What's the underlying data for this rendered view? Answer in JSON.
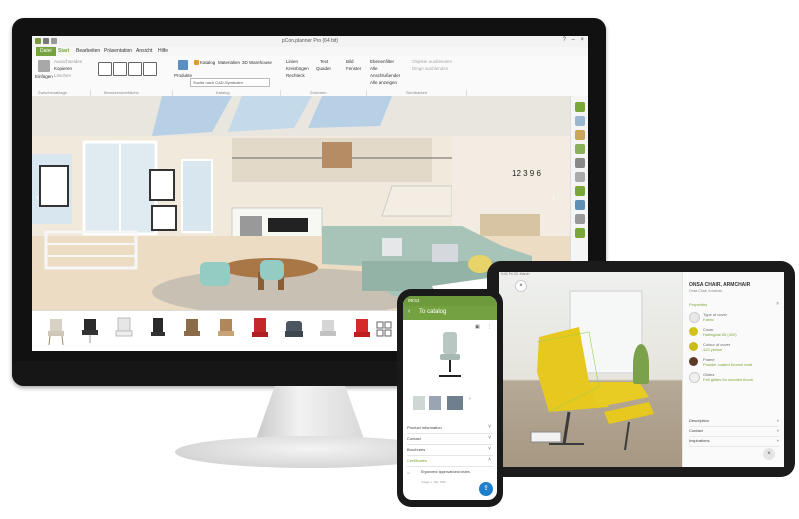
{
  "desktop_app": {
    "title": "pCon.planner Pro (64 bit)",
    "menu": [
      "Datei",
      "Start",
      "Bearbeiten",
      "Präsentation",
      "Ansicht",
      "Hilfe"
    ],
    "ribbon": {
      "paste_label": "Einfügen",
      "clipboard_items": [
        "Ausschneiden",
        "Kopieren",
        "Löschen"
      ],
      "catalog_items": [
        "Katalog",
        "Materialien",
        "3D Warehouse"
      ],
      "products_label": "Produkte",
      "search_placeholder": "Suche nach CAD-Symbolen",
      "draw_items": [
        "Linien",
        "Kreisbögen",
        "Rechteck",
        "Quader",
        "Text",
        "Bild",
        "Fenster"
      ],
      "layer_label": "Ebenenfilter",
      "layer_items": [
        "Alle",
        "Anschlußender",
        "Alle anzeigen",
        "Objekte ausblenden",
        "Dinge ausblenden"
      ],
      "groups": [
        "Zwischenablage",
        "Benutzeroberfläche",
        "Katalog",
        "Zeichnen",
        "Sichtbarkeit"
      ]
    },
    "clock_text": "12 3 9 6"
  },
  "tablet_app": {
    "status_bar": "9:41 Fri 20. March",
    "close_icon": "close-icon",
    "product_title": "ONSA CHAIR, ARMCHAIR",
    "product_subtitle": "Onsa Chair, Armchair",
    "section_properties": "Properties",
    "properties": [
      {
        "label": "Type of cover",
        "value": "Fabric",
        "color": "#e8e8e8"
      },
      {
        "label": "Cover",
        "value": "Hallingdal 65 (420)",
        "color": "#d4c21a"
      },
      {
        "label": "Colour of cover",
        "value": "420 yellow",
        "color": "#cdbb1c"
      },
      {
        "label": "Frame",
        "value": "Powder coated bronze matt",
        "color": "#5b3a26"
      },
      {
        "label": "Glides",
        "value": "Felt glides for wooden floors",
        "color": "#f0f0f0"
      }
    ],
    "bottom_sections": [
      "Description",
      "Contact",
      "Inspirations"
    ]
  },
  "phone_app": {
    "status_time": "09:53",
    "header_title": "To catalog",
    "accordion": [
      "Product information",
      "Contact",
      "Brochures",
      "Certificates"
    ],
    "certificate_item": "Ergonomic approval/seal chairs",
    "certificate_sub": "Image 1, Tam PDF"
  },
  "colors": {
    "brand_green": "#74a340",
    "fab_blue": "#1e7fcc",
    "chair_yellow": "#e6c81f"
  }
}
